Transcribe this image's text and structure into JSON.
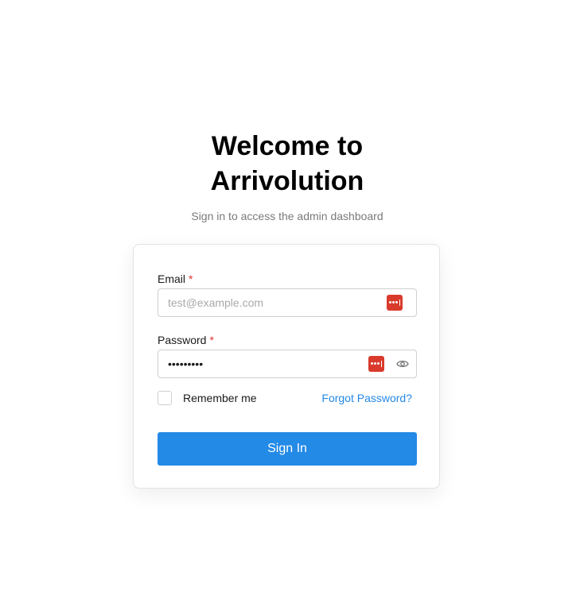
{
  "header": {
    "title": "Welcome to Arrivolution",
    "subtitle": "Sign in to access the admin dashboard"
  },
  "form": {
    "email": {
      "label": "Email",
      "required_mark": "*",
      "placeholder": "test@example.com",
      "value": ""
    },
    "password": {
      "label": "Password",
      "required_mark": "*",
      "value": "•••••••••"
    },
    "remember_label": "Remember me",
    "remember_checked": false,
    "forgot_label": "Forgot Password?",
    "submit_label": "Sign In"
  },
  "icons": {
    "password_manager": "password-manager-icon",
    "toggle_visibility": "eye-icon"
  },
  "colors": {
    "accent": "#238ae6",
    "link": "#2489e6",
    "required": "#e03131",
    "password_manager": "#d93a2b"
  }
}
